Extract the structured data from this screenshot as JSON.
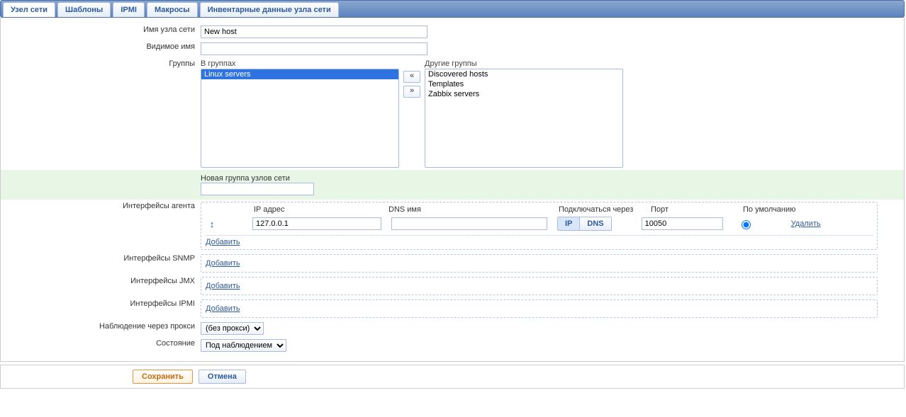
{
  "tabs": [
    {
      "label": "Узел сети"
    },
    {
      "label": "Шаблоны"
    },
    {
      "label": "IPMI"
    },
    {
      "label": "Макросы"
    },
    {
      "label": "Инвентарные данные узла сети"
    }
  ],
  "labels": {
    "hostname": "Имя узла сети",
    "visible_name": "Видимое имя",
    "groups": "Группы",
    "in_groups": "В группах",
    "other_groups": "Другие группы",
    "new_group": "Новая группа узлов сети",
    "agent_ifaces": "Интерфейсы агента",
    "snmp_ifaces": "Интерфейсы SNMP",
    "jmx_ifaces": "Интерфейсы JMX",
    "ipmi_ifaces": "Интерфейсы IPMI",
    "monitored_by_proxy": "Наблюдение через прокси",
    "status": "Состояние",
    "ip_addr": "IP адрес",
    "dns_name": "DNS имя",
    "connect_via": "Подключаться через",
    "port": "Порт",
    "default": "По умолчанию",
    "add": "Добавить",
    "delete": "Удалить",
    "ip_btn": "IP",
    "dns_btn": "DNS",
    "arrow_left": "«",
    "arrow_right": "»"
  },
  "values": {
    "hostname": "New host",
    "visible_name": "",
    "new_group": "",
    "ip": "127.0.0.1",
    "dns": "",
    "port": "10050"
  },
  "groups_in": [
    "Linux servers"
  ],
  "groups_other": [
    "Discovered hosts",
    "Templates",
    "Zabbix servers"
  ],
  "proxy_options": [
    "(без прокси)"
  ],
  "status_options": [
    "Под наблюдением"
  ],
  "footer": {
    "save": "Сохранить",
    "cancel": "Отмена"
  }
}
